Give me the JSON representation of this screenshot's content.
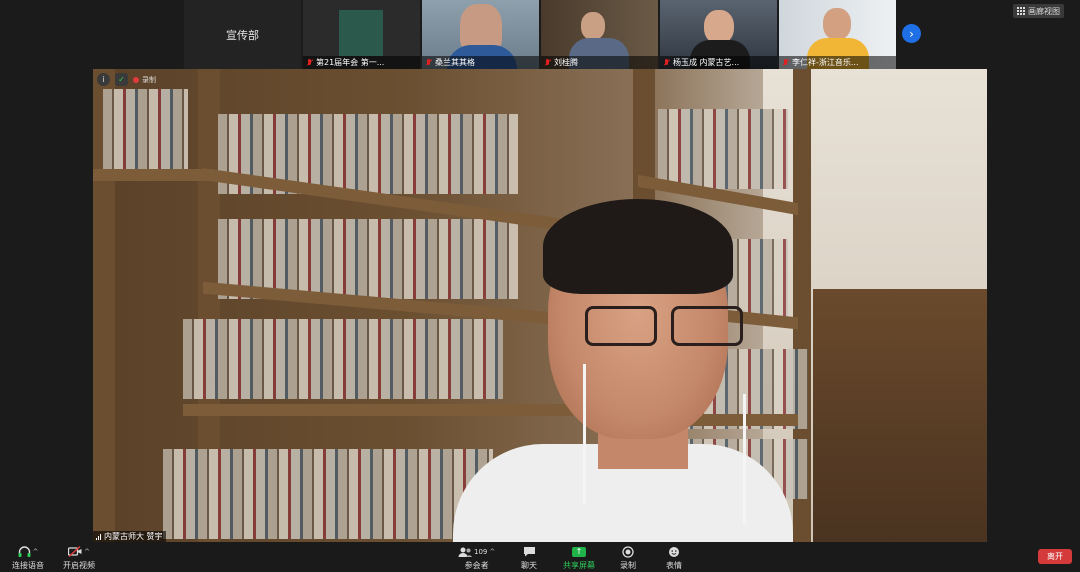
{
  "thumbnails": [
    {
      "name": "宣传部",
      "type": "name-only"
    },
    {
      "name": "第21届年会 第一...",
      "muted": true,
      "bg": "#2b5a4c"
    },
    {
      "name": "桑兰其其格",
      "muted": true,
      "bg": "#6a7d8a"
    },
    {
      "name": "刘桂腾",
      "muted": true,
      "bg": "#5a4a3c"
    },
    {
      "name": "杨玉成 内蒙古艺...",
      "muted": true,
      "bg": "#3c4a5a"
    },
    {
      "name": "李仁祥-浙江音乐...",
      "muted": true,
      "bg": "#d8dde2"
    }
  ],
  "next_arrow": "›",
  "view_toggle": {
    "label": "画廊视图",
    "icon": "grid-icon"
  },
  "video_overlay": {
    "info": "i",
    "shield": "✓",
    "record_label": "录制"
  },
  "speaker": {
    "name": "内蒙古师大 赞宇"
  },
  "toolbar": {
    "audio": {
      "label": "连接语音",
      "icon": "headphones-icon"
    },
    "video": {
      "label": "开启视频",
      "icon": "video-off-icon"
    },
    "participants": {
      "label": "参会者",
      "count": "109",
      "icon": "participants-icon"
    },
    "chat": {
      "label": "聊天",
      "icon": "chat-icon"
    },
    "share": {
      "label": "共享屏幕",
      "icon": "share-screen-icon"
    },
    "record": {
      "label": "录制",
      "icon": "record-icon"
    },
    "reactions": {
      "label": "表情",
      "icon": "emoji-icon"
    },
    "leave": {
      "label": "离开"
    }
  },
  "colors": {
    "accent_green": "#2ecf5a",
    "leave_red": "#d43a3a",
    "arrow_blue": "#1f6fe6"
  }
}
